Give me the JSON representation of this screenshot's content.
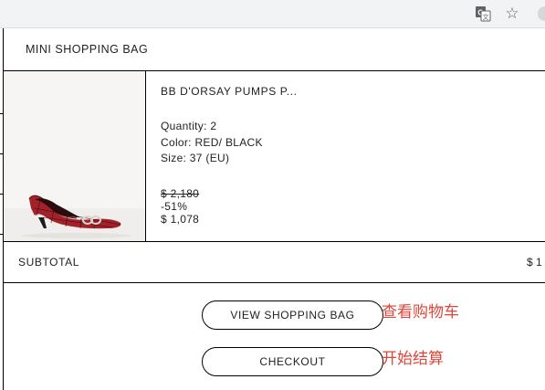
{
  "browser": {
    "icons": [
      "translate-icon",
      "star-icon",
      "profile-icon"
    ]
  },
  "bag": {
    "title": "MINI SHOPPING BAG",
    "item": {
      "name": "BB D'ORSAY PUMPS P...",
      "quantity": "Quantity: 2",
      "color": "Color: RED/ BLACK",
      "size": "Size: 37 (EU)",
      "original_price": "$ 2,180",
      "discount": "-51%",
      "price": "$ 1,078",
      "image": "red-black-plaid-kitten-heel-pump"
    },
    "subtotal_label": "SUBTOTAL",
    "subtotal_value": "$ 1",
    "view_bag_label": "VIEW SHOPPING BAG",
    "checkout_label": "CHECKOUT"
  },
  "annotations": {
    "view_bag": "查看购物车",
    "checkout": "开始结算"
  },
  "colors": {
    "annotation": "#e0453a",
    "shoe_red": "#a3222a",
    "toolbar": "#f1f3f4"
  }
}
